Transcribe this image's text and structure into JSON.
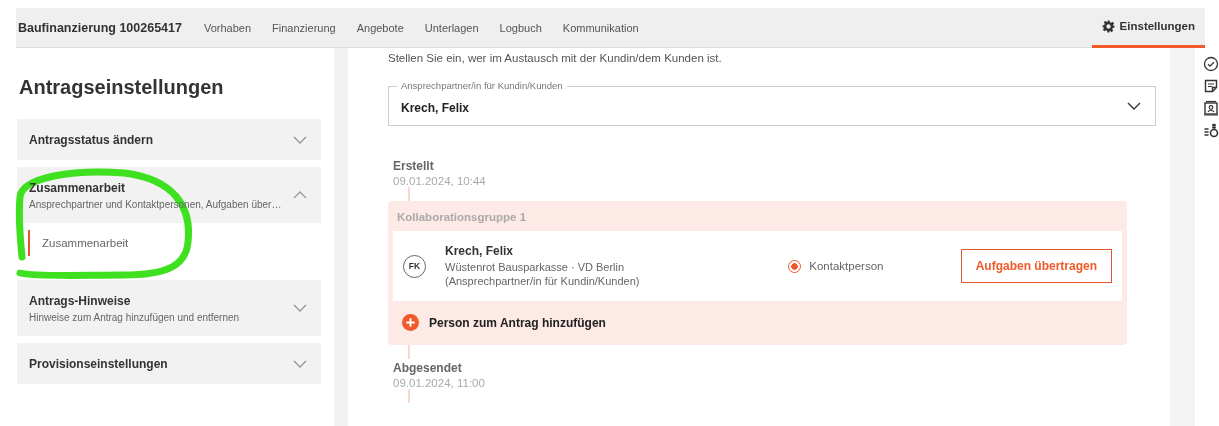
{
  "header": {
    "title": "Baufinanzierung 100265417",
    "nav": [
      {
        "label": "Vorhaben",
        "selected": false
      },
      {
        "label": "Finanzierung",
        "selected": false
      },
      {
        "label": "Angebote",
        "selected": false
      },
      {
        "label": "Unterlagen",
        "selected": false
      },
      {
        "label": "Logbuch",
        "selected": false
      },
      {
        "label": "Kommunikation",
        "selected": false
      }
    ],
    "settings": {
      "label": "Einstellungen",
      "selected": true
    }
  },
  "sidebar": {
    "title": "Antragseinstellungen",
    "sections": [
      {
        "title": "Antragsstatus ändern",
        "expanded": false
      },
      {
        "title": "Zusammenarbeit",
        "subtitle": "Ansprechpartner und Kontaktpersonen, Aufgaben über…",
        "expanded": true,
        "children": [
          {
            "label": "Zusammenarbeit",
            "selected": true
          }
        ]
      },
      {
        "title": "Antrags-Hinweise",
        "subtitle": "Hinweise zum Antrag hinzufügen und entfernen",
        "expanded": false
      },
      {
        "title": "Provisionseinstellungen",
        "expanded": false
      }
    ]
  },
  "main": {
    "intro": "Stellen Sie ein, wer im Austausch mit der Kundin/dem Kunden ist.",
    "contact_select": {
      "label": "Ansprechpartner/in für Kundin/Kunden",
      "value": "Krech, Felix"
    },
    "timeline": [
      {
        "kind": "event",
        "title": "Erstellt",
        "time": "09.01.2024, 10:44"
      },
      {
        "kind": "group",
        "title": "Kollaborationsgruppe 1",
        "members": [
          {
            "initials": "FK",
            "name": "Krech, Felix",
            "organization": "Wüstenrot Bausparkasse · VD Berlin",
            "role": "(Ansprechpartner/in für Kundin/Kunden)",
            "contact": {
              "label": "Kontaktperson",
              "selected": true
            },
            "action": "Aufgaben übertragen"
          }
        ],
        "add_label": "Person zum Antrag hinzufügen"
      },
      {
        "kind": "event",
        "title": "Abgesendet",
        "time": "09.01.2024, 11:00"
      }
    ]
  }
}
